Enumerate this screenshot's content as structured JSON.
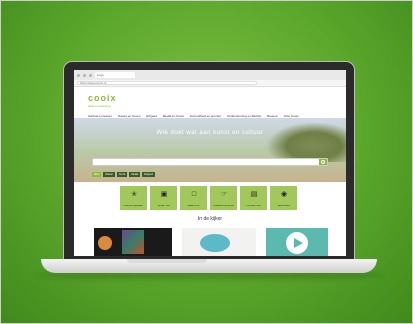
{
  "browser": {
    "tab_title": "Logo",
    "url": "https://www.cooix.nl"
  },
  "site": {
    "logo_text": "cooix",
    "logo_tagline": "tekst en beleving",
    "nav": [
      "Aanbod en lessen",
      "Natuur en Groen",
      "Erfgoed",
      "Media en Kunst",
      "Gezondheid en sporten",
      "Ondersteuning en Welzijn",
      "Bestuur",
      "Over Cooix"
    ],
    "hero_title": "Wie doet wat aan kunst en cultuur",
    "search_placeholder": "",
    "filters": [
      "Alles",
      "Natuur",
      "Kunst",
      "Media",
      "Erfgoed"
    ],
    "tiles": [
      {
        "label": "INSPIRATIEKAART",
        "icon": "figure-icon"
      },
      {
        "label": "VRIJE TIJD",
        "icon": "film-icon"
      },
      {
        "label": "LEERSTOF",
        "icon": "screen-icon"
      },
      {
        "label": "ONDERSTEUNING",
        "icon": "hand-icon"
      },
      {
        "label": "PROJECTEN",
        "icon": "monitor-icon"
      },
      {
        "label": "VERHALEN",
        "icon": "badge-icon"
      }
    ],
    "section_title": "In de kijker"
  },
  "colors": {
    "accent": "#8dbb3e",
    "tile": "#a2c75a",
    "background_green": "#5aa62b"
  }
}
